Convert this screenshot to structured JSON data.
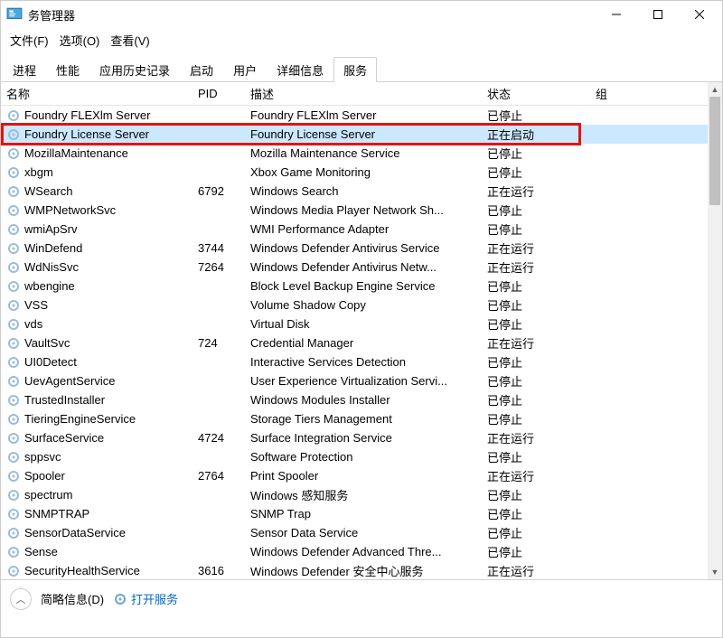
{
  "window": {
    "title": "务管理器"
  },
  "menu": {
    "file": "文件(F)",
    "options": "选项(O)",
    "view": "查看(V)"
  },
  "tabs": {
    "processes": "进程",
    "performance": "性能",
    "appHistory": "应用历史记录",
    "startup": "启动",
    "users": "用户",
    "details": "详细信息",
    "services": "服务"
  },
  "columns": {
    "name": "名称",
    "pid": "PID",
    "desc": "描述",
    "status": "状态",
    "group": "组"
  },
  "services": [
    {
      "name": "Foundry FLEXlm Server",
      "pid": "",
      "desc": "Foundry FLEXlm Server",
      "status": "已停止",
      "hl": false
    },
    {
      "name": "Foundry License Server",
      "pid": "",
      "desc": "Foundry License Server",
      "status": "正在启动",
      "hl": true
    },
    {
      "name": "MozillaMaintenance",
      "pid": "",
      "desc": "Mozilla Maintenance Service",
      "status": "已停止",
      "hl": false
    },
    {
      "name": "xbgm",
      "pid": "",
      "desc": "Xbox Game Monitoring",
      "status": "已停止",
      "hl": false
    },
    {
      "name": "WSearch",
      "pid": "6792",
      "desc": "Windows Search",
      "status": "正在运行",
      "hl": false
    },
    {
      "name": "WMPNetworkSvc",
      "pid": "",
      "desc": "Windows Media Player Network Sh...",
      "status": "已停止",
      "hl": false
    },
    {
      "name": "wmiApSrv",
      "pid": "",
      "desc": "WMI Performance Adapter",
      "status": "已停止",
      "hl": false
    },
    {
      "name": "WinDefend",
      "pid": "3744",
      "desc": "Windows Defender Antivirus Service",
      "status": "正在运行",
      "hl": false
    },
    {
      "name": "WdNisSvc",
      "pid": "7264",
      "desc": "Windows Defender Antivirus Netw...",
      "status": "正在运行",
      "hl": false
    },
    {
      "name": "wbengine",
      "pid": "",
      "desc": "Block Level Backup Engine Service",
      "status": "已停止",
      "hl": false
    },
    {
      "name": "VSS",
      "pid": "",
      "desc": "Volume Shadow Copy",
      "status": "已停止",
      "hl": false
    },
    {
      "name": "vds",
      "pid": "",
      "desc": "Virtual Disk",
      "status": "已停止",
      "hl": false
    },
    {
      "name": "VaultSvc",
      "pid": "724",
      "desc": "Credential Manager",
      "status": "正在运行",
      "hl": false
    },
    {
      "name": "UI0Detect",
      "pid": "",
      "desc": "Interactive Services Detection",
      "status": "已停止",
      "hl": false
    },
    {
      "name": "UevAgentService",
      "pid": "",
      "desc": "User Experience Virtualization Servi...",
      "status": "已停止",
      "hl": false
    },
    {
      "name": "TrustedInstaller",
      "pid": "",
      "desc": "Windows Modules Installer",
      "status": "已停止",
      "hl": false
    },
    {
      "name": "TieringEngineService",
      "pid": "",
      "desc": "Storage Tiers Management",
      "status": "已停止",
      "hl": false
    },
    {
      "name": "SurfaceService",
      "pid": "4724",
      "desc": "Surface Integration Service",
      "status": "正在运行",
      "hl": false
    },
    {
      "name": "sppsvc",
      "pid": "",
      "desc": "Software Protection",
      "status": "已停止",
      "hl": false
    },
    {
      "name": "Spooler",
      "pid": "2764",
      "desc": "Print Spooler",
      "status": "正在运行",
      "hl": false
    },
    {
      "name": "spectrum",
      "pid": "",
      "desc": "Windows 感知服务",
      "status": "已停止",
      "hl": false
    },
    {
      "name": "SNMPTRAP",
      "pid": "",
      "desc": "SNMP Trap",
      "status": "已停止",
      "hl": false
    },
    {
      "name": "SensorDataService",
      "pid": "",
      "desc": "Sensor Data Service",
      "status": "已停止",
      "hl": false
    },
    {
      "name": "Sense",
      "pid": "",
      "desc": "Windows Defender Advanced Thre...",
      "status": "已停止",
      "hl": false
    },
    {
      "name": "SecurityHealthService",
      "pid": "3616",
      "desc": "Windows Defender 安全中心服务",
      "status": "正在运行",
      "hl": false
    }
  ],
  "footer": {
    "fewer": "简略信息(D)",
    "openServices": "打开服务"
  }
}
